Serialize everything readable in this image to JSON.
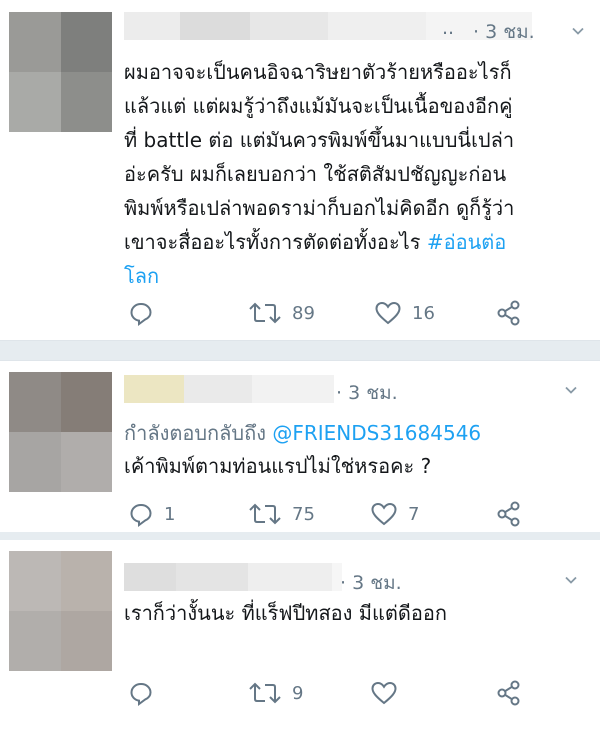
{
  "tweets": [
    {
      "time": "· 3 ชม.",
      "dots": "..",
      "body": "ผมอาจจะเป็นคนอิจฉาริษยาตัวร้ายหรืออะไรก็\nแล้วแต่ แต่ผมรู้ว่าถึงแม้มันจะเป็นเนื้อของอีกคู่\nที่ battle ต่อ แต่มันควรพิมพ์ขึ้นมาแบบนี่เปล่า\nอ่ะครับ ผมก็เลยบอกว่า ใช้สติสัมปชัญญะก่อน\nพิมพ์หรือเปล่าพอดราม่าก็บอกไม่คิดอีก ดูก็รู้ว่า\nเขาจะสื่ออะไรทั้งการตัดต่อทั้งอะไร ",
      "hashtag": "#อ่อนต่อ\nโลก",
      "retweets": "89",
      "likes": "16",
      "replies": ""
    },
    {
      "time": "· 3 ชม.",
      "replying_prefix": "กำลังตอบกลับถึง ",
      "mention": "@FRIENDS31684546",
      "body": "เค้าพิมพ์ตามท่อนแรปไม่ใช่หรอคะ ?",
      "replies": "1",
      "retweets": "75",
      "likes": "7"
    },
    {
      "time": "· 3 ชม.",
      "body": "เราก็ว่างั้นนะ ที่แร็ฟปีทสอง มีแต่ดีออก",
      "replies": "",
      "retweets": "9",
      "likes": ""
    }
  ],
  "icons": {
    "reply": "reply-icon",
    "retweet": "retweet-icon",
    "like": "heart-icon",
    "share": "share-icon",
    "caret": "chevron-down-icon"
  },
  "colors": {
    "link": "#1da1f2",
    "muted": "#657786",
    "separator": "#e6ecf0"
  }
}
